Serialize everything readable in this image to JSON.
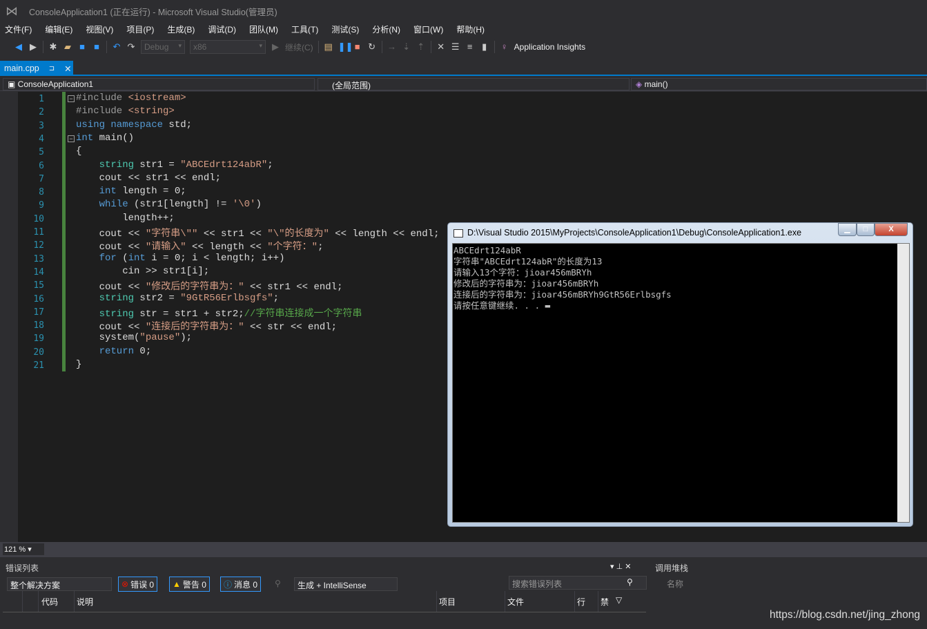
{
  "window": {
    "title": "ConsoleApplication1 (正在运行) - Microsoft Visual Studio(管理员)",
    "logo_icon": "visual-studio-logo"
  },
  "menu": [
    "文件(F)",
    "编辑(E)",
    "视图(V)",
    "项目(P)",
    "生成(B)",
    "调试(D)",
    "团队(M)",
    "工具(T)",
    "测试(S)",
    "分析(N)",
    "窗口(W)",
    "帮助(H)"
  ],
  "toolbar": {
    "config": "Debug",
    "platform": "x86",
    "continue": "继续(C)",
    "app_insights": "Application Insights"
  },
  "tab": {
    "label": "main.cpp",
    "pin": "⊐",
    "close": "✕"
  },
  "nav": {
    "project": "ConsoleApplication1",
    "scope": "(全局范围)",
    "member": "main()"
  },
  "code": [
    [
      {
        "c": "pp",
        "s": "#include "
      },
      {
        "c": "st",
        "s": "<iostream>"
      }
    ],
    [
      {
        "c": "pp",
        "s": "#include "
      },
      {
        "c": "st",
        "s": "<string>"
      }
    ],
    [
      {
        "c": "kw",
        "s": "using namespace "
      },
      {
        "c": "",
        "s": "std;"
      }
    ],
    [
      {
        "c": "kw",
        "s": "int "
      },
      {
        "c": "",
        "s": "main()"
      }
    ],
    [
      {
        "c": "",
        "s": "{"
      }
    ],
    [
      {
        "c": "ty",
        "s": "    string "
      },
      {
        "c": "",
        "s": "str1 = "
      },
      {
        "c": "st",
        "s": "\"ABCEdrt124abR\""
      },
      {
        "c": "",
        "s": ";"
      }
    ],
    [
      {
        "c": "",
        "s": "    cout << str1 << endl;"
      }
    ],
    [
      {
        "c": "kw",
        "s": "    int "
      },
      {
        "c": "",
        "s": "length = 0;"
      }
    ],
    [
      {
        "c": "kw",
        "s": "    while "
      },
      {
        "c": "",
        "s": "(str1[length] != "
      },
      {
        "c": "st",
        "s": "'\\0'"
      },
      {
        "c": "",
        "s": ")"
      }
    ],
    [
      {
        "c": "",
        "s": "        length++;"
      }
    ],
    [
      {
        "c": "",
        "s": "    cout << "
      },
      {
        "c": "st",
        "s": "\"字符串\\\"\""
      },
      {
        "c": "",
        "s": " << str1 << "
      },
      {
        "c": "st",
        "s": "\"\\\"的长度为\""
      },
      {
        "c": "",
        "s": " << length << endl;"
      }
    ],
    [
      {
        "c": "",
        "s": "    cout << "
      },
      {
        "c": "st",
        "s": "\"请输入\""
      },
      {
        "c": "",
        "s": " << length << "
      },
      {
        "c": "st",
        "s": "\"个字符：\""
      },
      {
        "c": "",
        "s": ";"
      }
    ],
    [
      {
        "c": "kw",
        "s": "    for "
      },
      {
        "c": "",
        "s": "("
      },
      {
        "c": "kw",
        "s": "int "
      },
      {
        "c": "",
        "s": "i = 0; i < length; i++)"
      }
    ],
    [
      {
        "c": "",
        "s": "        cin >> str1[i];"
      }
    ],
    [
      {
        "c": "",
        "s": "    cout << "
      },
      {
        "c": "st",
        "s": "\"修改后的字符串为：\""
      },
      {
        "c": "",
        "s": " << str1 << endl;"
      }
    ],
    [
      {
        "c": "ty",
        "s": "    string "
      },
      {
        "c": "",
        "s": "str2 = "
      },
      {
        "c": "st",
        "s": "\"9GtR56Erlbsgfs\""
      },
      {
        "c": "",
        "s": ";"
      }
    ],
    [
      {
        "c": "ty",
        "s": "    string "
      },
      {
        "c": "",
        "s": "str = str1 + str2;"
      },
      {
        "c": "cm",
        "s": "//字符串连接成一个字符串"
      }
    ],
    [
      {
        "c": "",
        "s": "    cout << "
      },
      {
        "c": "st",
        "s": "\"连接后的字符串为：\""
      },
      {
        "c": "",
        "s": " << str << endl;"
      }
    ],
    [
      {
        "c": "",
        "s": "    system("
      },
      {
        "c": "st",
        "s": "\"pause\""
      },
      {
        "c": "",
        "s": ");"
      }
    ],
    [
      {
        "c": "kw",
        "s": "    return "
      },
      {
        "c": "",
        "s": "0;"
      }
    ],
    [
      {
        "c": "",
        "s": "}"
      }
    ]
  ],
  "console": {
    "title": "D:\\Visual Studio 2015\\MyProjects\\ConsoleApplication1\\Debug\\ConsoleApplication1.exe",
    "output": "ABCEdrt124abR\n字符串\"ABCEdrt124abR\"的长度为13\n请输入13个字符：jioar456mBRYh\n修改后的字符串为：jioar456mBRYh\n连接后的字符串为：jioar456mBRYh9GtR56Erlbsgfs\n请按任意键继续. . . ▬",
    "min": "▁",
    "max": "□",
    "close": "X"
  },
  "zoom": "121 %",
  "errors": {
    "title": "错误列表",
    "scope": "整个解决方案",
    "errors": "错误 0",
    "warnings": "警告 0",
    "messages": "消息 0",
    "source": "生成 + IntelliSense",
    "search_placeholder": "搜索错误列表",
    "columns": [
      "代码",
      "说明",
      "项目",
      "文件",
      "行",
      "禁"
    ]
  },
  "callstack": {
    "title": "调用堆栈",
    "column": "名称"
  },
  "watermark": "https://blog.csdn.net/jing_zhong"
}
